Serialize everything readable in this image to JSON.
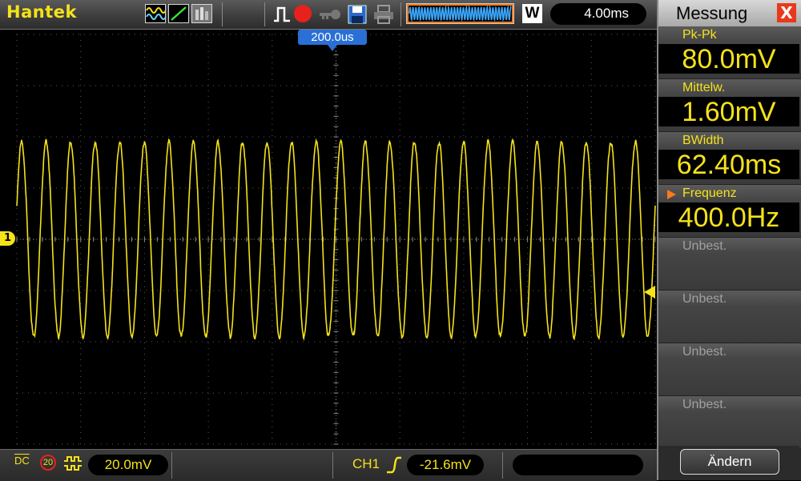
{
  "brand": "Hantek",
  "timebase": "4.00ms",
  "trigger_time": "200.0us",
  "acq_mode_label": "W",
  "bottom": {
    "coupling": "DC",
    "bw_limit": "20",
    "volts_div": "20.0mV",
    "trigger_channel": "CH1",
    "trigger_level": "-21.6mV"
  },
  "channel_marker": "1",
  "panel": {
    "title": "Messung",
    "close": "X",
    "items": [
      {
        "label": "Pk-Pk",
        "value": "80.0mV"
      },
      {
        "label": "Mittelw.",
        "value": "1.60mV"
      },
      {
        "label": "BWidth",
        "value": "62.40ms"
      },
      {
        "label": "Frequenz",
        "value": "400.0Hz"
      },
      {
        "label": "Unbest.",
        "value": ""
      },
      {
        "label": "Unbest.",
        "value": ""
      },
      {
        "label": "Unbest.",
        "value": ""
      },
      {
        "label": "Unbest.",
        "value": ""
      }
    ],
    "change_button": "Ändern"
  },
  "colors": {
    "trace": "#f4e21a",
    "grid": "#5a5a5a",
    "trigger_box": "#2a6fd6",
    "run_indicator": "#e8211c",
    "close_button": "#e8391c",
    "selection_marker": "#ff7a1a"
  },
  "waveform": {
    "cycles_on_screen": 26,
    "amplitude_divisions": 1.9
  }
}
